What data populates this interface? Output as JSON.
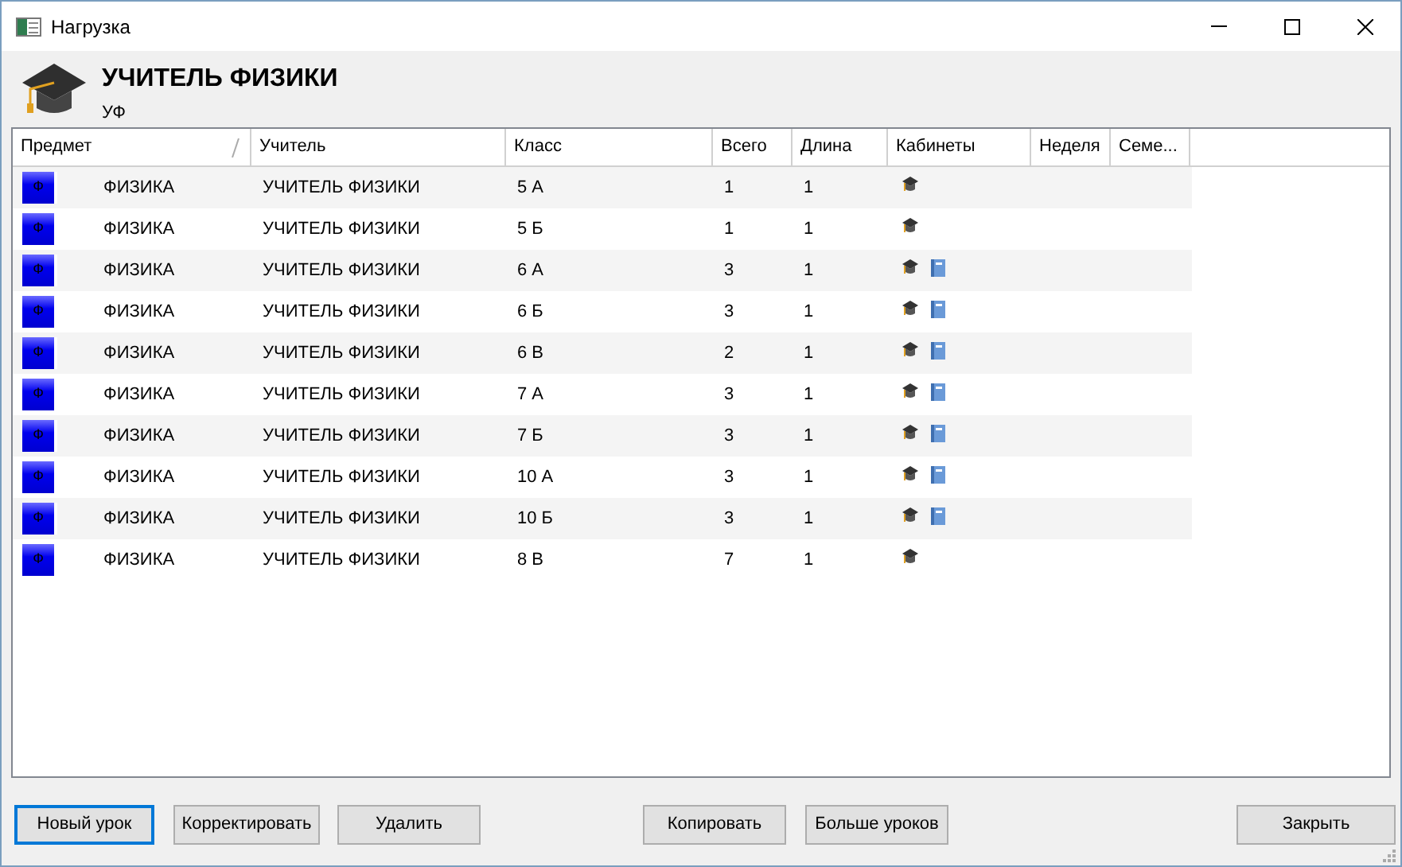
{
  "window": {
    "title": "Нагрузка"
  },
  "header": {
    "title": "УЧИТЕЛЬ ФИЗИКИ",
    "subtitle": "УФ"
  },
  "table": {
    "columns": [
      {
        "label": "Предмет",
        "sorted": true
      },
      {
        "label": "Учитель",
        "sorted": false
      },
      {
        "label": "Класс",
        "sorted": false
      },
      {
        "label": "Всего",
        "sorted": false
      },
      {
        "label": "Длина",
        "sorted": false
      },
      {
        "label": "Кабинеты",
        "sorted": false
      },
      {
        "label": "Неделя",
        "sorted": false
      },
      {
        "label": "Семе...",
        "sorted": false
      }
    ],
    "rows": [
      {
        "icon_letter": "Ф",
        "subject": "ФИЗИКА",
        "teacher": "УЧИТЕЛЬ ФИЗИКИ",
        "class": "5 А",
        "total": "1",
        "length": "1",
        "rooms": [
          {
            "kind": "cap"
          }
        ]
      },
      {
        "icon_letter": "Ф",
        "subject": "ФИЗИКА",
        "teacher": "УЧИТЕЛЬ ФИЗИКИ",
        "class": "5 Б",
        "total": "1",
        "length": "1",
        "rooms": [
          {
            "kind": "cap"
          }
        ]
      },
      {
        "icon_letter": "Ф",
        "subject": "ФИЗИКА",
        "teacher": "УЧИТЕЛЬ ФИЗИКИ",
        "class": "6 А",
        "total": "3",
        "length": "1",
        "rooms": [
          {
            "kind": "cap"
          },
          {
            "kind": "book"
          }
        ]
      },
      {
        "icon_letter": "Ф",
        "subject": "ФИЗИКА",
        "teacher": "УЧИТЕЛЬ ФИЗИКИ",
        "class": "6 Б",
        "total": "3",
        "length": "1",
        "rooms": [
          {
            "kind": "cap"
          },
          {
            "kind": "book"
          }
        ]
      },
      {
        "icon_letter": "Ф",
        "subject": "ФИЗИКА",
        "teacher": "УЧИТЕЛЬ ФИЗИКИ",
        "class": "6 В",
        "total": "2",
        "length": "1",
        "rooms": [
          {
            "kind": "cap"
          },
          {
            "kind": "book"
          }
        ]
      },
      {
        "icon_letter": "Ф",
        "subject": "ФИЗИКА",
        "teacher": "УЧИТЕЛЬ ФИЗИКИ",
        "class": "7 А",
        "total": "3",
        "length": "1",
        "rooms": [
          {
            "kind": "cap"
          },
          {
            "kind": "book"
          }
        ]
      },
      {
        "icon_letter": "Ф",
        "subject": "ФИЗИКА",
        "teacher": "УЧИТЕЛЬ ФИЗИКИ",
        "class": "7 Б",
        "total": "3",
        "length": "1",
        "rooms": [
          {
            "kind": "cap"
          },
          {
            "kind": "book"
          }
        ]
      },
      {
        "icon_letter": "Ф",
        "subject": "ФИЗИКА",
        "teacher": "УЧИТЕЛЬ ФИЗИКИ",
        "class": "10 А",
        "total": "3",
        "length": "1",
        "rooms": [
          {
            "kind": "cap"
          },
          {
            "kind": "book"
          }
        ]
      },
      {
        "icon_letter": "Ф",
        "subject": "ФИЗИКА",
        "teacher": "УЧИТЕЛЬ ФИЗИКИ",
        "class": "10 Б",
        "total": "3",
        "length": "1",
        "rooms": [
          {
            "kind": "cap"
          },
          {
            "kind": "book"
          }
        ]
      },
      {
        "icon_letter": "Ф",
        "subject": "ФИЗИКА",
        "teacher": "УЧИТЕЛЬ ФИЗИКИ",
        "class": "8 В",
        "total": "7",
        "length": "1",
        "rooms": [
          {
            "kind": "cap"
          }
        ]
      }
    ]
  },
  "buttons": [
    {
      "label": "Новый урок",
      "default": true
    },
    {
      "label": "Корректировать",
      "default": false
    },
    {
      "label": "Удалить",
      "default": false
    },
    {
      "label": "Копировать",
      "default": false
    },
    {
      "label": "Больше уроков",
      "default": false
    },
    {
      "label": "Закрыть",
      "default": false
    }
  ]
}
